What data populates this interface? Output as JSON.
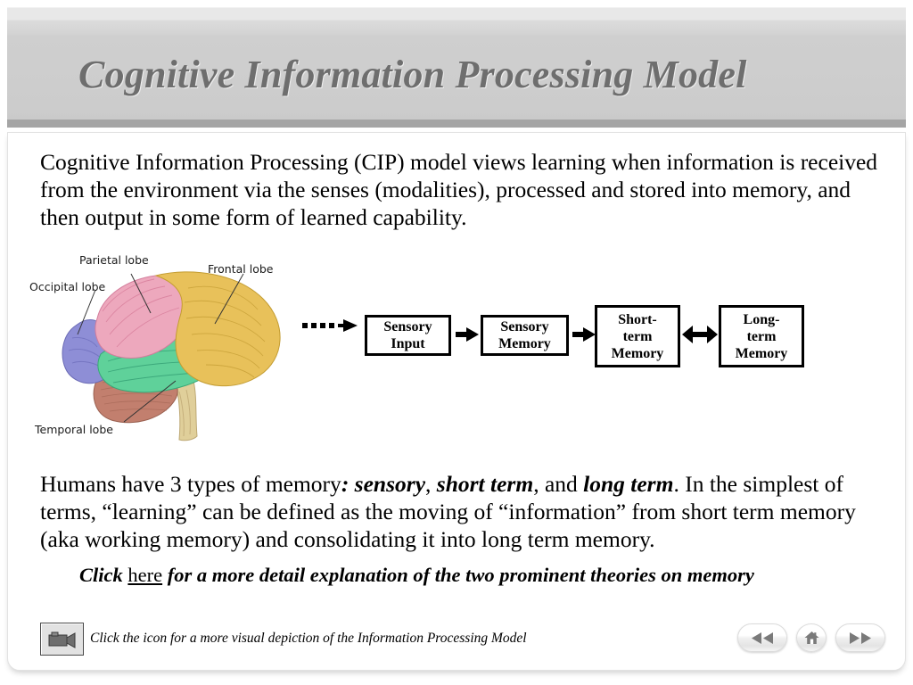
{
  "header": {
    "title": "Cognitive Information Processing Model"
  },
  "content": {
    "intro_paragraph_part1": "Cognitive Information Processing (CIP) model views learning when information is received from the environment via the senses (modalities), processed and stored into memory, and then output in some form of learned capability.",
    "memory_paragraph": {
      "seg1": "Humans have 3 types of memory",
      "seg2": ": sensory",
      "seg3": ", ",
      "seg4": "short term",
      "seg5": ", and ",
      "seg6": "long term",
      "seg7": ". In the simplest of terms, “learning” can be defined as the moving of “information” from short term memory  (aka working memory) and consolidating it into long term memory."
    },
    "click_here_line": {
      "before": "Click ",
      "link": "here",
      "after": " for a more detail explanation of the two prominent theories on memory"
    }
  },
  "brain_diagram": {
    "labels": [
      {
        "name": "parietal-lobe",
        "text": "Parietal lobe"
      },
      {
        "name": "frontal-lobe",
        "text": "Frontal lobe"
      },
      {
        "name": "occipital-lobe",
        "text": "Occipital lobe"
      },
      {
        "name": "temporal-lobe",
        "text": "Temporal lobe"
      }
    ],
    "colors": {
      "frontal": "#e8c15a",
      "parietal": "#eda8bd",
      "occipital": "#8e8ed6",
      "temporal": "#5fd19a",
      "cerebellum": "#c27f6e",
      "brainstem": "#e0cf9a"
    }
  },
  "flow_diagram": {
    "input_arrow": "dotted-arrow-right",
    "boxes": [
      {
        "name": "sensory-input-box",
        "label": "Sensory\nInput"
      },
      {
        "name": "sensory-memory-box",
        "label": "Sensory\nMemory"
      },
      {
        "name": "short-term-memory-box",
        "label": "Short-\nterm\nMemory"
      },
      {
        "name": "long-term-memory-box",
        "label": "Long-\nterm\nMemory"
      }
    ],
    "connector_1": "arrow-right",
    "connector_2": "arrow-right",
    "connector_3": "arrow-bidirectional"
  },
  "footer": {
    "video_icon": "video-camera-icon",
    "video_caption": "Click the icon for a more visual depiction of the Information Processing Model",
    "nav": {
      "previous": "rewind-icon",
      "home": "home-icon",
      "next": "fast-forward-icon"
    }
  }
}
